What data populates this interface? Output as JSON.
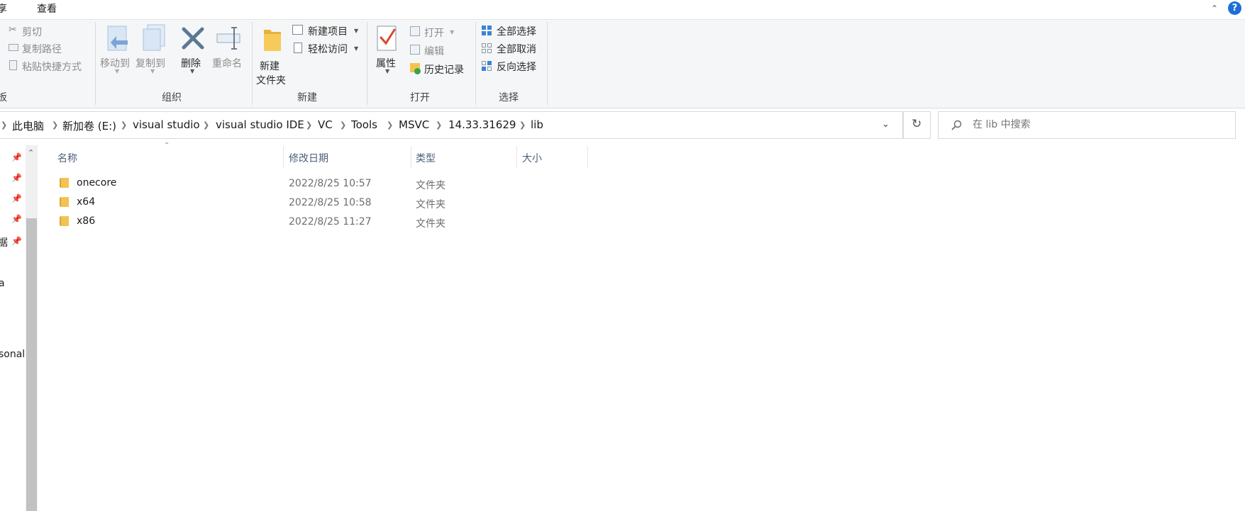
{
  "menubar": {
    "tabs": [
      "享",
      "查看"
    ]
  },
  "ribbon": {
    "clipboard": {
      "cut": "剪切",
      "copy_path": "复制路径",
      "paste_shortcut": "粘贴快捷方式",
      "group_label": "板"
    },
    "organize": {
      "move_to": "移动到",
      "copy_to": "复制到",
      "delete": "删除",
      "rename": "重命名",
      "group_label": "组织"
    },
    "new": {
      "new_folder_line1": "新建",
      "new_folder_line2": "文件夹",
      "new_item": "新建项目",
      "easy_access": "轻松访问",
      "group_label": "新建"
    },
    "open": {
      "properties": "属性",
      "open": "打开",
      "edit": "编辑",
      "history": "历史记录",
      "group_label": "打开"
    },
    "select": {
      "select_all": "全部选择",
      "select_none": "全部取消",
      "invert": "反向选择",
      "group_label": "选择"
    }
  },
  "address": {
    "crumbs": [
      "此电脑",
      "新加卷 (E:)",
      "visual studio",
      "visual studio IDE",
      "VC",
      "Tools",
      "MSVC",
      "14.33.31629",
      "lib"
    ]
  },
  "search": {
    "placeholder": "在 lib 中搜索"
  },
  "nav": {
    "items": [
      "据",
      "a",
      "sonal"
    ]
  },
  "list": {
    "columns": [
      "名称",
      "修改日期",
      "类型",
      "大小"
    ],
    "rows": [
      {
        "name": "onecore",
        "date": "2022/8/25 10:57",
        "type": "文件夹"
      },
      {
        "name": "x64",
        "date": "2022/8/25 10:58",
        "type": "文件夹"
      },
      {
        "name": "x86",
        "date": "2022/8/25 11:27",
        "type": "文件夹"
      }
    ]
  },
  "colors": {
    "folder": "#f3c352",
    "accent": "#1e6ed6",
    "scrollbar": "#c2c2c2"
  }
}
